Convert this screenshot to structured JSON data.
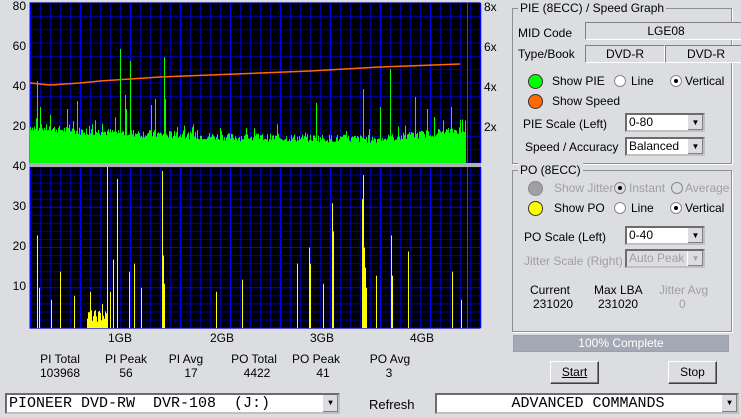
{
  "left_axis_top": [
    "80",
    "60",
    "40",
    "20"
  ],
  "left_axis_bottom": [
    "40",
    "30",
    "20",
    "10"
  ],
  "right_axis": [
    "8x",
    "6x",
    "4x",
    "2x"
  ],
  "x_axis": [
    "1GB",
    "2GB",
    "3GB",
    "4GB"
  ],
  "stats": [
    {
      "label": "PI Total",
      "value": "103968"
    },
    {
      "label": "PI Peak",
      "value": "56"
    },
    {
      "label": "PI Avg",
      "value": "17"
    },
    {
      "label": "PO Total",
      "value": "4422"
    },
    {
      "label": "PO Peak",
      "value": "41"
    },
    {
      "label": "PO Avg",
      "value": "3"
    }
  ],
  "pie_group": {
    "title": "PIE (8ECC) / Speed Graph",
    "mid_label": "MID Code",
    "mid_value": "LGE08",
    "type_label": "Type/Book",
    "type_value": "DVD-R",
    "book_value": "DVD-R",
    "show_pie": "Show PIE",
    "line": "Line",
    "vertical": "Vertical",
    "show_speed": "Show Speed",
    "scale_label": "PIE Scale (Left)",
    "scale_value": "0-80",
    "accuracy_label": "Speed / Accuracy",
    "accuracy_value": "Balanced"
  },
  "po_group": {
    "title": "PO (8ECC)",
    "show_jitter": "Show Jitter",
    "instant": "Instant",
    "average": "Average",
    "show_po": "Show PO",
    "line": "Line",
    "vertical": "Vertical",
    "scale_label": "PO Scale (Left)",
    "scale_value": "0-40",
    "jitter_scale_label": "Jitter Scale (Right)",
    "jitter_scale_value": "Auto Peak",
    "current_label": "Current",
    "current_value": "231020",
    "maxlba_label": "Max LBA",
    "maxlba_value": "231020",
    "jitter_avg_label": "Jitter Avg",
    "jitter_avg_value": "0"
  },
  "progress": {
    "text": "100% Complete",
    "percent": 100
  },
  "buttons": {
    "start": "Start",
    "stop": "Stop",
    "refresh": "Refresh"
  },
  "drive": "PIONEER DVD-RW  DVR-108  (J:)",
  "advanced": "ADVANCED COMMANDS",
  "colors": {
    "pie": "#00ff00",
    "speed": "#ff6a00",
    "po": "#ffff00",
    "grid": "#0000a0",
    "major": "#0000ff",
    "end": "#ff0000"
  },
  "chart_data": {
    "type": "bar",
    "x_unit": "GB",
    "x_range": [
      0.1,
      4.48
    ],
    "pie": {
      "ylim": [
        0,
        80
      ],
      "baseline": [
        [
          0.1,
          18
        ],
        [
          0.6,
          16
        ],
        [
          2.1,
          13
        ],
        [
          3.6,
          12
        ],
        [
          4.46,
          17
        ]
      ],
      "spikes": [
        [
          0.17,
          41
        ],
        [
          0.2,
          28
        ],
        [
          0.47,
          27
        ],
        [
          0.57,
          31
        ],
        [
          1.0,
          57
        ],
        [
          1.05,
          34
        ],
        [
          1.1,
          51
        ],
        [
          1.06,
          27
        ],
        [
          1.31,
          29
        ],
        [
          1.35,
          32
        ],
        [
          1.44,
          53
        ],
        [
          1.45,
          32
        ],
        [
          2.96,
          30
        ],
        [
          3.43,
          37
        ],
        [
          3.6,
          28
        ],
        [
          3.7,
          47
        ],
        [
          3.95,
          33
        ],
        [
          4.07,
          27
        ],
        [
          4.31,
          28
        ]
      ]
    },
    "speed": {
      "ylim": [
        0,
        8
      ],
      "points": [
        [
          0.1,
          4.0
        ],
        [
          0.3,
          3.9
        ],
        [
          0.6,
          4.0
        ],
        [
          0.8,
          4.1
        ],
        [
          1.1,
          4.2
        ],
        [
          1.4,
          4.3
        ],
        [
          1.9,
          4.4
        ],
        [
          2.9,
          4.6
        ],
        [
          3.6,
          4.8
        ],
        [
          4.4,
          4.95
        ]
      ]
    },
    "po": {
      "ylim": [
        0,
        40
      ],
      "cluster": [
        [
          0.67,
          0.87,
          3
        ]
      ],
      "spikes": [
        [
          0.17,
          23
        ],
        [
          0.19,
          10
        ],
        [
          0.31,
          7
        ],
        [
          0.4,
          14
        ],
        [
          0.54,
          8
        ],
        [
          0.7,
          9
        ],
        [
          0.82,
          6
        ],
        [
          0.87,
          40
        ],
        [
          0.9,
          9
        ],
        [
          0.93,
          17
        ],
        [
          0.97,
          37
        ],
        [
          1.09,
          14
        ],
        [
          1.14,
          16
        ],
        [
          1.21,
          10
        ],
        [
          1.42,
          39
        ],
        [
          1.43,
          18
        ],
        [
          1.44,
          11
        ],
        [
          1.96,
          9
        ],
        [
          2.22,
          12
        ],
        [
          2.77,
          16
        ],
        [
          2.89,
          20
        ],
        [
          2.9,
          16
        ],
        [
          3.03,
          11
        ],
        [
          3.12,
          31
        ],
        [
          3.13,
          24
        ],
        [
          3.42,
          32
        ],
        [
          3.43,
          38
        ],
        [
          3.44,
          20
        ],
        [
          3.45,
          15
        ],
        [
          3.46,
          10
        ],
        [
          3.56,
          13
        ],
        [
          3.71,
          23
        ],
        [
          3.72,
          13
        ],
        [
          3.88,
          19
        ],
        [
          4.32,
          14
        ],
        [
          4.41,
          7
        ]
      ]
    }
  }
}
